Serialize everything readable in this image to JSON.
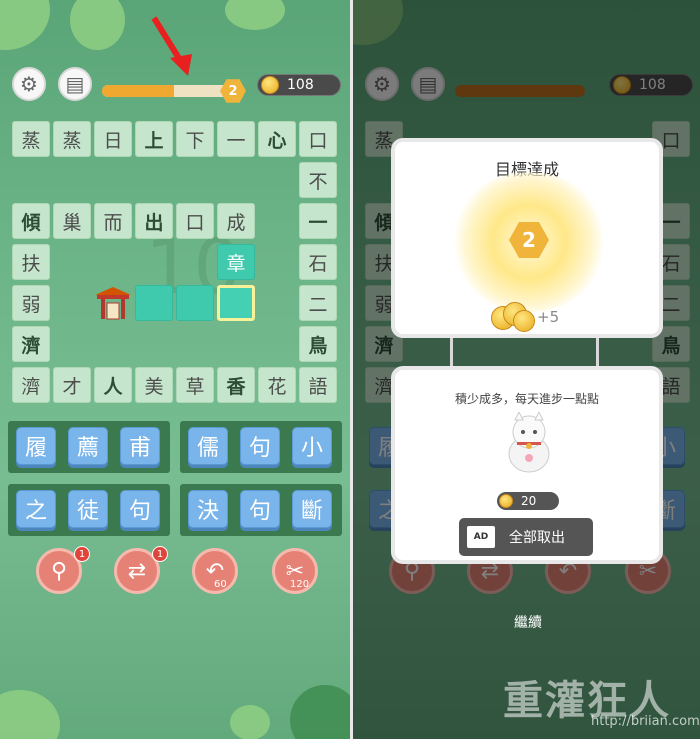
{
  "colors": {
    "accent_teal": "#3fc9ad",
    "tile_blue": "#79b4ea",
    "tool_red": "#e58275",
    "coin_gold": "#f0b43a"
  },
  "hud": {
    "settings_icon": "gear-icon",
    "book_icon": "book-icon",
    "level": "2",
    "level_progress": 0.55,
    "coins": "108"
  },
  "board": {
    "bg_number": "10",
    "row1": [
      "蒸",
      "蒸",
      "日",
      "上",
      "下",
      "一",
      "心",
      "口"
    ],
    "col_right": [
      "不",
      "一",
      "石",
      "二",
      "鳥"
    ],
    "row3": [
      "傾",
      "巢",
      "而",
      "出",
      "口",
      "成"
    ],
    "col_left": [
      "扶",
      "弱",
      "濟"
    ],
    "answer_top": "章",
    "row8": [
      "濟",
      "才",
      "人",
      "美",
      "草",
      "香",
      "花",
      "語"
    ]
  },
  "tiles": {
    "row1_left": [
      "履",
      "薦",
      "甫"
    ],
    "row1_right": [
      "儒",
      "句",
      "小"
    ],
    "row2_left": [
      "之",
      "徒",
      "句"
    ],
    "row2_right": [
      "決",
      "句",
      "斷"
    ]
  },
  "tools": {
    "search_badge": "1",
    "shuffle_badge": "1",
    "undo_cost": "60",
    "cut_cost": "120"
  },
  "dialog": {
    "title": "目標達成",
    "level": "2",
    "reward": "+5",
    "message": "積少成多，每天進步一點點",
    "piggy_coins": "20",
    "ad_icon": "AD",
    "collect_label": "全部取出",
    "continue_label": "繼續"
  },
  "watermark": {
    "logo": "重灌狂人",
    "url": "http://briian.com/"
  }
}
